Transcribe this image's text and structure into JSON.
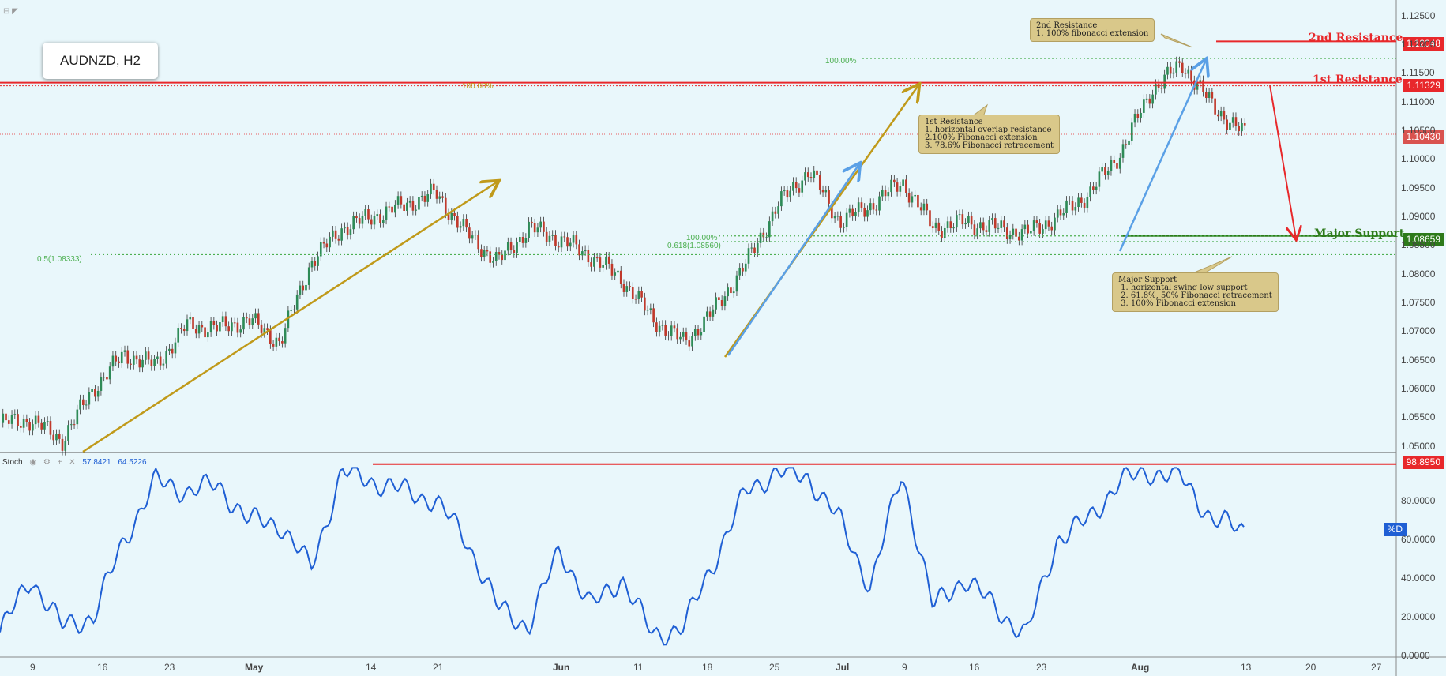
{
  "chart_title": "AUDNZD, H2",
  "toolbar": {
    "collapse_icon": "minus-square-icon",
    "expand_icon": "triangle-corner-icon"
  },
  "price_axis": {
    "ticks": [
      "1.12500",
      "1.12000",
      "1.11500",
      "1.11000",
      "1.10500",
      "1.10000",
      "1.09500",
      "1.09000",
      "1.08500",
      "1.08000",
      "1.07500",
      "1.07000",
      "1.06500",
      "1.06000",
      "1.05500",
      "1.05000"
    ]
  },
  "stoch_axis": {
    "ticks": [
      "80.0000",
      "60.0000",
      "40.0000",
      "20.0000",
      "0.0000"
    ]
  },
  "date_axis": {
    "ticks": [
      "9",
      "16",
      "23",
      "May",
      "14",
      "21",
      "Jun",
      "11",
      "18",
      "25",
      "Jul",
      "9",
      "16",
      "23",
      "Aug",
      "13",
      "20",
      "27"
    ]
  },
  "price_tags": {
    "r2": "1.12048",
    "r1": "1.11329",
    "last": "1.10430",
    "support": "1.08659",
    "stoch": "98.8950"
  },
  "levels": {
    "r2_label": "2nd Resistance",
    "r1_label": "1st Resistance",
    "support_label": "Major Support"
  },
  "fib_labels": {
    "f100_top": "100.00%",
    "f100_left": "100.00%",
    "f100_support": "100.00%",
    "f618": "0.618(1.08560)",
    "f05": "0.5(1.08333)"
  },
  "notes": {
    "r2": "2nd Resistance\n1. 100% fibonacci extension",
    "r1": "1st Resistance\n1. horizontal overlap resistance\n2.100% Fibonacci extension\n3. 78.6% Fibonacci retracement",
    "support": "Major Support\n 1. horizontal swing low support\n 2. 61.8%, 50% Fibonacci retracement\n 3. 100% Fibonacci extension"
  },
  "stoch": {
    "name": "Stoch",
    "k_value": "57.8421",
    "d_value": "64.5226",
    "d_label": "%D",
    "icons": [
      "eye-icon",
      "gear-icon",
      "plus-icon",
      "close-icon"
    ]
  },
  "colors": {
    "background": "#e9f7fb",
    "resistance": "#e8282b",
    "support": "#2d7a1a",
    "last_price": "#d9534f",
    "fib_green": "#4caf50",
    "gold_arrow": "#c09a1a",
    "blue_arrow": "#5aa0e6",
    "stoch_line": "#1f5fd4",
    "candle_up": "#2e8b57",
    "candle_down": "#c0392b"
  },
  "chart_data": [
    {
      "type": "candlestick",
      "title": "AUDNZD, H2",
      "ylim": [
        1.049,
        1.127
      ],
      "x_ticks": [
        "9",
        "16",
        "23",
        "May",
        "14",
        "21",
        "Jun",
        "11",
        "18",
        "25",
        "Jul",
        "9",
        "16",
        "23",
        "Aug",
        "13",
        "20",
        "27"
      ],
      "series": [
        {
          "name": "AUDNZD, H2",
          "x": [
            "Apr 6",
            "Apr 9",
            "Apr 12",
            "Apr 16",
            "Apr 20",
            "Apr 23",
            "Apr 27",
            "May 1",
            "May 4",
            "May 8",
            "May 11",
            "May 14",
            "May 17",
            "May 21",
            "May 24",
            "May 28",
            "Jun 1",
            "Jun 4",
            "Jun 7",
            "Jun 11",
            "Jun 14",
            "Jun 18",
            "Jun 21",
            "Jun 25",
            "Jun 28",
            "Jul 2",
            "Jul 5",
            "Jul 9",
            "Jul 12",
            "Jul 16",
            "Jul 19",
            "Jul 23",
            "Jul 26",
            "Jul 30",
            "Aug 1",
            "Aug 3",
            "Aug 6",
            "Aug 8",
            "Aug 9",
            "Aug 10",
            "Aug 13"
          ],
          "values": [
            1.054,
            1.0545,
            1.051,
            1.06,
            1.066,
            1.064,
            1.071,
            1.0705,
            1.072,
            1.068,
            1.082,
            1.088,
            1.09,
            1.092,
            1.094,
            1.087,
            1.082,
            1.088,
            1.086,
            1.083,
            1.079,
            1.072,
            1.068,
            1.074,
            1.082,
            1.092,
            1.098,
            1.089,
            1.092,
            1.096,
            1.088,
            1.089,
            1.088,
            1.087,
            1.09,
            1.094,
            1.101,
            1.112,
            1.1165,
            1.109,
            1.1043
          ]
        }
      ],
      "levels": {
        "second_resistance": 1.12048,
        "first_resistance": 1.11329,
        "last": 1.1043,
        "major_support": 1.08659,
        "fib_618": 1.0856,
        "fib_05": 1.08333
      }
    },
    {
      "type": "line",
      "title": "Stoch",
      "ylim": [
        0,
        100
      ],
      "series": [
        {
          "name": "%D",
          "x": [
            "Apr 6",
            "Apr 9",
            "Apr 12",
            "Apr 16",
            "Apr 20",
            "Apr 23",
            "Apr 27",
            "May 1",
            "May 4",
            "May 8",
            "May 11",
            "May 14",
            "May 17",
            "May 21",
            "May 24",
            "May 28",
            "Jun 1",
            "Jun 4",
            "Jun 7",
            "Jun 11",
            "Jun 14",
            "Jun 18",
            "Jun 21",
            "Jun 25",
            "Jun 28",
            "Jul 2",
            "Jul 5",
            "Jul 9",
            "Jul 12",
            "Jul 16",
            "Jul 19",
            "Jul 23",
            "Jul 26",
            "Jul 30",
            "Aug 1",
            "Aug 3",
            "Aug 6",
            "Aug 8",
            "Aug 9",
            "Aug 10",
            "Aug 13"
          ],
          "values": [
            12,
            40,
            15,
            20,
            60,
            90,
            85,
            88,
            70,
            68,
            45,
            95,
            90,
            85,
            80,
            60,
            25,
            15,
            55,
            25,
            40,
            10,
            15,
            50,
            85,
            95,
            92,
            70,
            35,
            95,
            25,
            40,
            25,
            10,
            60,
            70,
            90,
            95,
            92,
            70,
            65
          ]
        }
      ],
      "reference_line": 98.895
    }
  ]
}
